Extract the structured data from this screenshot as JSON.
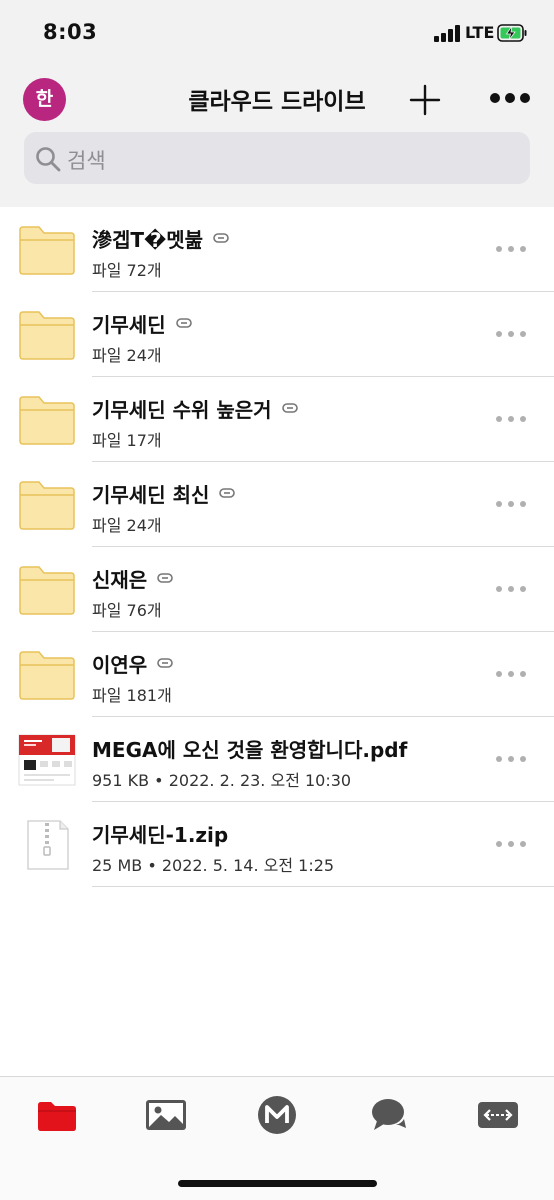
{
  "status_bar": {
    "time": "8:03",
    "network": "LTE"
  },
  "nav": {
    "avatar_initial": "한",
    "title": "클라우드 드라이브"
  },
  "search": {
    "placeholder": "검색"
  },
  "files": [
    {
      "name": "滲겝T�멧붎",
      "meta": "파일 72개",
      "type": "folder",
      "shared_link": true
    },
    {
      "name": "기무세딘",
      "meta": "파일 24개",
      "type": "folder",
      "shared_link": true
    },
    {
      "name": "기무세딘 수위 높은거",
      "meta": "파일 17개",
      "type": "folder",
      "shared_link": true
    },
    {
      "name": "기무세딘 최신",
      "meta": "파일 24개",
      "type": "folder",
      "shared_link": true
    },
    {
      "name": "신재은",
      "meta": "파일 76개",
      "type": "folder",
      "shared_link": true
    },
    {
      "name": "이연우",
      "meta": "파일 181개",
      "type": "folder",
      "shared_link": true
    },
    {
      "name": "MEGA에 오신 것을 환영합니다.pdf",
      "meta": "951 KB • 2022. 2. 23. 오전 10:30",
      "type": "pdf",
      "shared_link": false
    },
    {
      "name": "기무세딘-1.zip",
      "meta": "25 MB • 2022. 5. 14. 오전 1:25",
      "type": "zip",
      "shared_link": false
    }
  ],
  "tabs": [
    {
      "id": "cloud-drive",
      "icon": "folder-icon",
      "active": true
    },
    {
      "id": "photos",
      "icon": "photo-icon",
      "active": false
    },
    {
      "id": "home",
      "icon": "mega-logo-icon",
      "active": false
    },
    {
      "id": "chat",
      "icon": "chat-icon",
      "active": false
    },
    {
      "id": "transfers",
      "icon": "transfer-icon",
      "active": false
    }
  ],
  "colors": {
    "accent": "#e3131b",
    "avatar": "#b8267f",
    "folder": "#f9e6a8",
    "folder_border": "#e8c25a"
  }
}
